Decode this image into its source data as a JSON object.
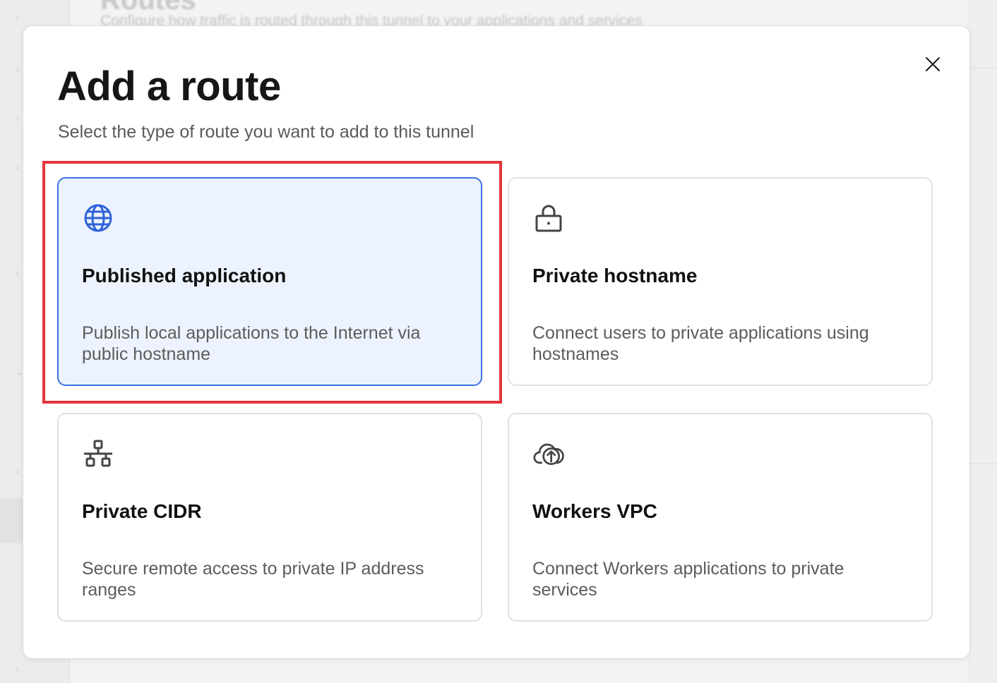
{
  "background": {
    "header_title": "Routes",
    "header_subtitle": "Configure how traffic is routed through this tunnel to your applications and services"
  },
  "modal": {
    "title": "Add a route",
    "subtitle": "Select the type of route you want to add to this tunnel",
    "close_icon": "close-icon",
    "options": [
      {
        "id": "published-application",
        "icon": "globe-icon",
        "title": "Published application",
        "description": "Publish local applications to the Internet via public hostname",
        "selected": true
      },
      {
        "id": "private-hostname",
        "icon": "lock-icon",
        "title": "Private hostname",
        "description": "Connect users to private applications using hostnames",
        "selected": false
      },
      {
        "id": "private-cidr",
        "icon": "network-icon",
        "title": "Private CIDR",
        "description": "Secure remote access to private IP address ranges",
        "selected": false
      },
      {
        "id": "workers-vpc",
        "icon": "cloud-upload-icon",
        "title": "Workers VPC",
        "description": "Connect Workers applications to private services",
        "selected": false
      }
    ]
  },
  "colors": {
    "selected_border": "#3b73e0",
    "selected_background": "#edf3fe",
    "globe_icon": "#2f63d8",
    "highlight_annotation": "#e5343f"
  }
}
